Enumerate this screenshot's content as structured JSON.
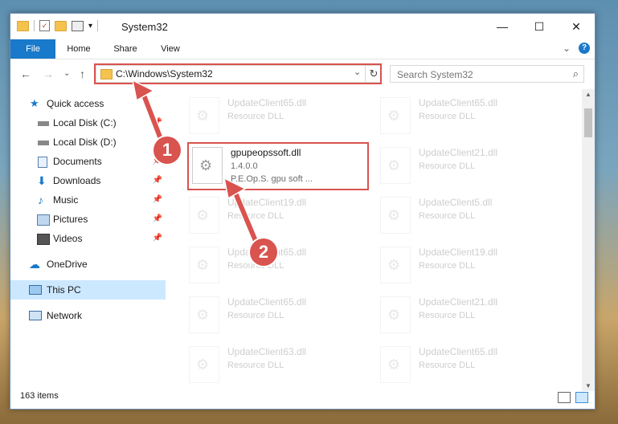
{
  "window": {
    "title": "System32",
    "minimize": "—",
    "maximize": "☐",
    "close": "✕"
  },
  "ribbon": {
    "tabs": [
      "File",
      "Home",
      "Share",
      "View"
    ],
    "expand": "⌄",
    "help": "?"
  },
  "navigation": {
    "back": "←",
    "forward": "→",
    "recent": "⌄",
    "up": "↑",
    "address": "C:\\Windows\\System32",
    "address_dropdown": "⌄",
    "refresh": "↻",
    "search_placeholder": "Search System32"
  },
  "sidebar": {
    "items": [
      {
        "label": "Quick access",
        "icon": "star-icon",
        "pinned": false
      },
      {
        "label": "Local Disk (C:)",
        "icon": "drive-icon",
        "pinned": true
      },
      {
        "label": "Local Disk (D:)",
        "icon": "drive-icon",
        "pinned": false
      },
      {
        "label": "Documents",
        "icon": "documents-icon",
        "pinned": true
      },
      {
        "label": "Downloads",
        "icon": "download-icon",
        "pinned": true
      },
      {
        "label": "Music",
        "icon": "music-icon",
        "pinned": true
      },
      {
        "label": "Pictures",
        "icon": "pictures-icon",
        "pinned": true
      },
      {
        "label": "Videos",
        "icon": "videos-icon",
        "pinned": true
      },
      {
        "label": "OneDrive",
        "icon": "cloud-icon",
        "pinned": false
      },
      {
        "label": "This PC",
        "icon": "computer-icon",
        "pinned": false,
        "selected": true
      },
      {
        "label": "Network",
        "icon": "network-icon",
        "pinned": false
      }
    ]
  },
  "files": {
    "highlighted": {
      "name": "gpupeopssoft.dll",
      "version": "1.4.0.0",
      "description": "P.E.Op.S. gpu soft ..."
    },
    "background": [
      {
        "name": "UpdateClient65.dll",
        "type": "Resource DLL"
      },
      {
        "name": "UpdateClient65.dll",
        "type": "Resource DLL"
      },
      {
        "name": "UpdateClient21.dll",
        "type": "Resource DLL"
      },
      {
        "name": "UpdateClient19.dll",
        "type": "Resource DLL"
      },
      {
        "name": "UpdateClient5.dll",
        "type": "Resource DLL"
      },
      {
        "name": "UpdateClient65.dll",
        "type": "Resource DLL"
      },
      {
        "name": "UpdateClient19.dll",
        "type": "Resource DLL"
      },
      {
        "name": "UpdateClient65.dll",
        "type": "Resource DLL"
      },
      {
        "name": "UpdateClient21.dll",
        "type": "Resource DLL"
      },
      {
        "name": "UpdateClient63.dll",
        "type": "Resource DLL"
      },
      {
        "name": "UpdateClient65.dll",
        "type": "Resource DLL"
      }
    ]
  },
  "status": {
    "items_count": "163 items"
  },
  "callouts": [
    "1",
    "2"
  ],
  "colors": {
    "accent": "#1979ca",
    "highlight": "#d9534f",
    "selected": "#cce8ff"
  }
}
